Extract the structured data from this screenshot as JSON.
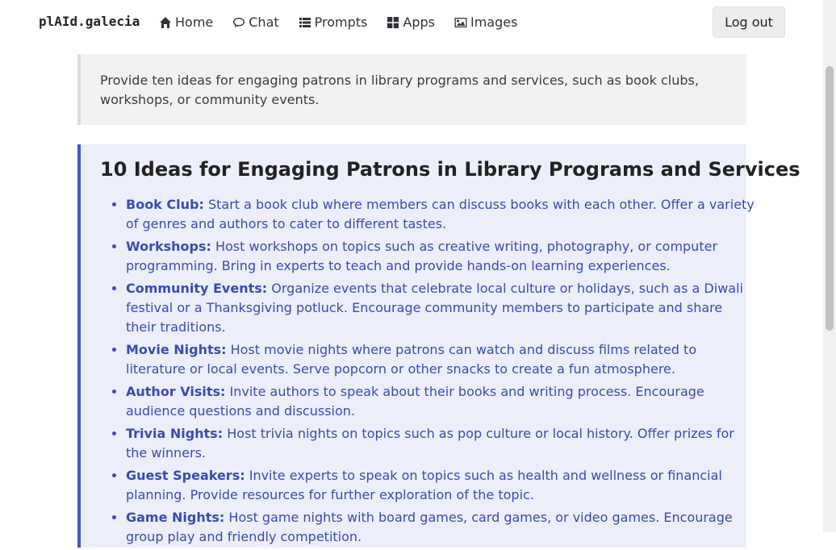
{
  "nav": {
    "brand": "plAId.galecia",
    "links": [
      {
        "label": "Home",
        "icon": "home-icon"
      },
      {
        "label": "Chat",
        "icon": "chat-icon"
      },
      {
        "label": "Prompts",
        "icon": "list-icon"
      },
      {
        "label": "Apps",
        "icon": "grid-icon"
      },
      {
        "label": "Images",
        "icon": "image-icon"
      }
    ],
    "logout_label": "Log out"
  },
  "prompt": {
    "text": "Provide ten ideas for engaging patrons in library programs and services, such as book clubs, workshops, or community events."
  },
  "answer": {
    "title": "10 Ideas for Engaging Patrons in Library Programs and Services",
    "items": [
      {
        "term": "Book Club:",
        "desc": "Start a book club where members can discuss books with each other. Offer a variety of genres and authors to cater to different tastes."
      },
      {
        "term": "Workshops:",
        "desc": "Host workshops on topics such as creative writing, photography, or computer programming. Bring in experts to teach and provide hands-on learning experiences."
      },
      {
        "term": "Community Events:",
        "desc": "Organize events that celebrate local culture or holidays, such as a Diwali festival or a Thanksgiving potluck. Encourage community members to participate and share their traditions."
      },
      {
        "term": "Movie Nights:",
        "desc": "Host movie nights where patrons can watch and discuss films related to literature or local events. Serve popcorn or other snacks to create a fun atmosphere."
      },
      {
        "term": "Author Visits:",
        "desc": "Invite authors to speak about their books and writing process. Encourage audience questions and discussion."
      },
      {
        "term": "Trivia Nights:",
        "desc": "Host trivia nights on topics such as pop culture or local history. Offer prizes for the winners."
      },
      {
        "term": "Guest Speakers:",
        "desc": "Invite experts to speak on topics such as health and wellness or financial planning. Provide resources for further exploration of the topic."
      },
      {
        "term": "Game Nights:",
        "desc": "Host game nights with board games, card games, or video games. Encourage group play and friendly competition."
      }
    ]
  },
  "colors": {
    "accent": "#4257c9",
    "answer_text": "#3b4bb0",
    "answer_bg": "#eceefa",
    "prompt_bg": "#f2f2f2"
  }
}
